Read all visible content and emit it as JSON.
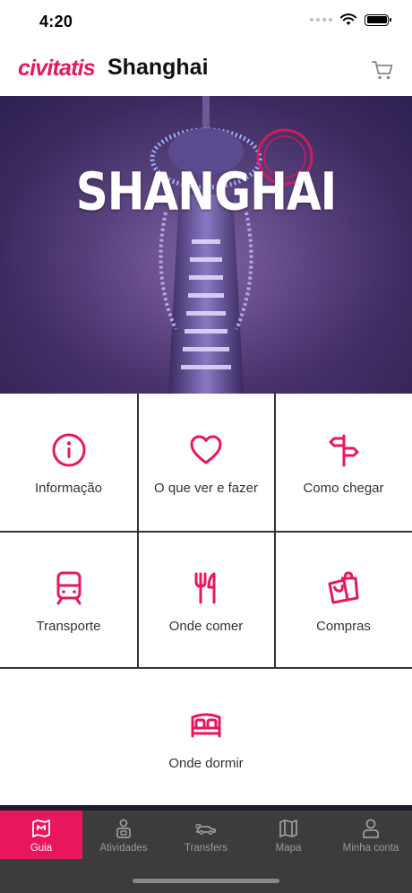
{
  "status_bar": {
    "time": "4:20"
  },
  "header": {
    "brand": "civitatis",
    "city": "Shanghai"
  },
  "hero": {
    "title": "SHANGHAI"
  },
  "menu": {
    "items": [
      {
        "label": "Informação",
        "icon": "info-icon"
      },
      {
        "label": "O que ver e fazer",
        "icon": "heart-icon"
      },
      {
        "label": "Como chegar",
        "icon": "signpost-icon"
      },
      {
        "label": "Transporte",
        "icon": "train-icon"
      },
      {
        "label": "Onde comer",
        "icon": "fork-knife-icon"
      },
      {
        "label": "Compras",
        "icon": "shopping-bags-icon"
      },
      {
        "label": "Onde dormir",
        "icon": "bed-icon"
      }
    ]
  },
  "tabs": [
    {
      "label": "Guia",
      "icon": "map-guide-icon",
      "active": true
    },
    {
      "label": "Atividades",
      "icon": "activities-icon"
    },
    {
      "label": "Transfers",
      "icon": "car-icon"
    },
    {
      "label": "Mapa",
      "icon": "map-icon"
    },
    {
      "label": "Minha conta",
      "icon": "user-icon"
    }
  ],
  "colors": {
    "accent": "#e8175d",
    "tab_bar": "#3c3c3c",
    "divider": "#333333"
  }
}
